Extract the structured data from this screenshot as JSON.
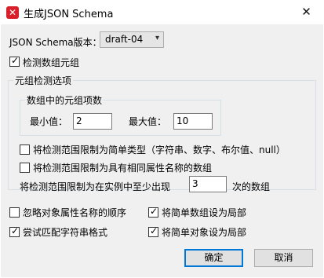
{
  "window": {
    "title": "生成JSON Schema",
    "icon": "altova-app-icon",
    "close_glyph": "✕"
  },
  "schema_version": {
    "label": "JSON Schema版本：",
    "selected": "draft-04"
  },
  "detect_tuples": {
    "label": "检测数组元组",
    "checked": true
  },
  "tuple_options": {
    "legend": "元组检测选项",
    "item_count": {
      "legend": "数组中的元组项数",
      "min_label": "最小值：",
      "min_value": "2",
      "max_label": "最大值：",
      "max_value": "10"
    },
    "limit_simple_types": {
      "label": "将检测范围限制为简单类型（字符串、数字、布尔值、null）",
      "checked": false
    },
    "limit_same_props": {
      "label": "将检测范围限制为具有相同属性名称的数组",
      "checked": false
    },
    "min_occurrence": {
      "label_before": "将检测范围限制为在实例中至少出现",
      "value": "3",
      "label_after": "次的数组"
    }
  },
  "options": {
    "ignore_property_order": {
      "label": "忽略对象属性名称的顺序",
      "checked": false
    },
    "simple_arrays_local": {
      "label": "将简单数组设为局部",
      "checked": true
    },
    "match_string_formats": {
      "label": "尝试匹配字符串格式",
      "checked": true
    },
    "simple_objects_local": {
      "label": "将简单对象设为局部",
      "checked": true
    }
  },
  "buttons": {
    "ok": "确定",
    "cancel": "取消"
  }
}
